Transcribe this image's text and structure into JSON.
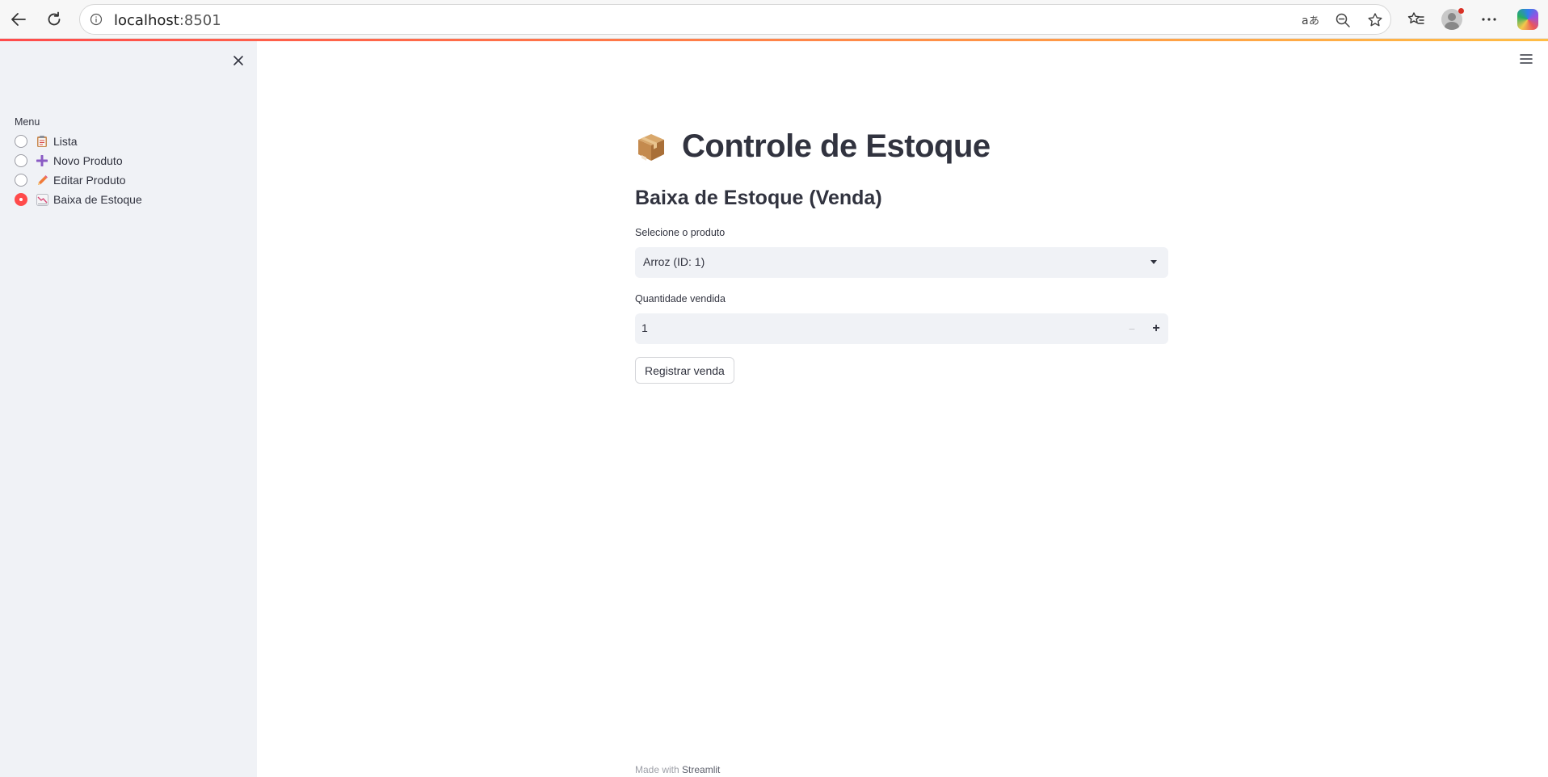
{
  "browser": {
    "url_host": "localhost",
    "url_port": ":8501"
  },
  "sidebar": {
    "menu_label": "Menu",
    "items": [
      {
        "label": "Lista",
        "icon": "clipboard-icon",
        "selected": false
      },
      {
        "label": "Novo Produto",
        "icon": "plus-icon",
        "selected": false
      },
      {
        "label": "Editar Produto",
        "icon": "pencil-icon",
        "selected": false
      },
      {
        "label": "Baixa de Estoque",
        "icon": "chart-decreasing-icon",
        "selected": true
      }
    ]
  },
  "main": {
    "title": "Controle de Estoque",
    "subtitle": "Baixa de Estoque (Venda)",
    "product_label": "Selecione o produto",
    "product_value": "Arroz (ID: 1)",
    "qty_label": "Quantidade vendida",
    "qty_value": "1",
    "qty_minus": "−",
    "qty_plus": "+",
    "submit_label": "Registrar venda"
  },
  "footer": {
    "made_with": "Made with",
    "brand": "Streamlit"
  },
  "colors": {
    "accent": "#ff4b4b",
    "sidebar_bg": "#f0f2f6",
    "text": "#31333f"
  }
}
